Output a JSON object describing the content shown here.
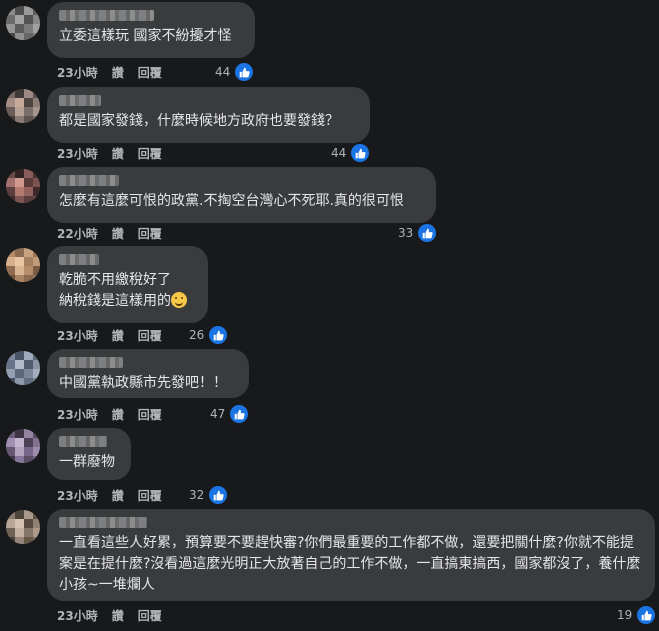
{
  "comments": [
    {
      "text": "立委這樣玩 國家不紛擾才怪",
      "time": "23小時",
      "like_label": "讚",
      "reply_label": "回覆",
      "reactions": "44"
    },
    {
      "text": "都是國家發錢，什麼時候地方政府也要發錢？",
      "time": "23小時",
      "like_label": "讚",
      "reply_label": "回覆",
      "reactions": "44"
    },
    {
      "text": "怎麼有這麼可恨的政黨.不掏空台灣心不死耶.真的很可恨",
      "time": "22小時",
      "like_label": "讚",
      "reply_label": "回覆",
      "reactions": "33"
    },
    {
      "text": "乾脆不用繳稅好了",
      "text2": "納稅錢是這樣用的",
      "time": "23小時",
      "like_label": "讚",
      "reply_label": "回覆",
      "reactions": "26"
    },
    {
      "text": "中國黨執政縣市先發吧！！",
      "time": "23小時",
      "like_label": "讚",
      "reply_label": "回覆",
      "reactions": "47"
    },
    {
      "text": "一群廢物",
      "time": "23小時",
      "like_label": "讚",
      "reply_label": "回覆",
      "reactions": "32"
    },
    {
      "text": "一直看這些人好累，預算要不要趕快審?你們最重要的工作都不做，還要把關什麼?你就不能提案是在提什麼?沒看過這麼光明正大放著自己的工作不做，一直搞東搞西，國家都沒了，養什麼小孩~一堆爛人",
      "time": "23小時",
      "like_label": "讚",
      "reply_label": "回覆",
      "reactions": "19"
    }
  ],
  "colors": {
    "background": "#18191a",
    "bubble": "#3a3b3c",
    "like_blue": "#1b74e4",
    "text": "#e4e6eb",
    "meta": "#b0b3b8"
  },
  "icons": {
    "reaction": "thumbs-up-icon",
    "emoji": "grinning-sweat-emoji-icon"
  }
}
